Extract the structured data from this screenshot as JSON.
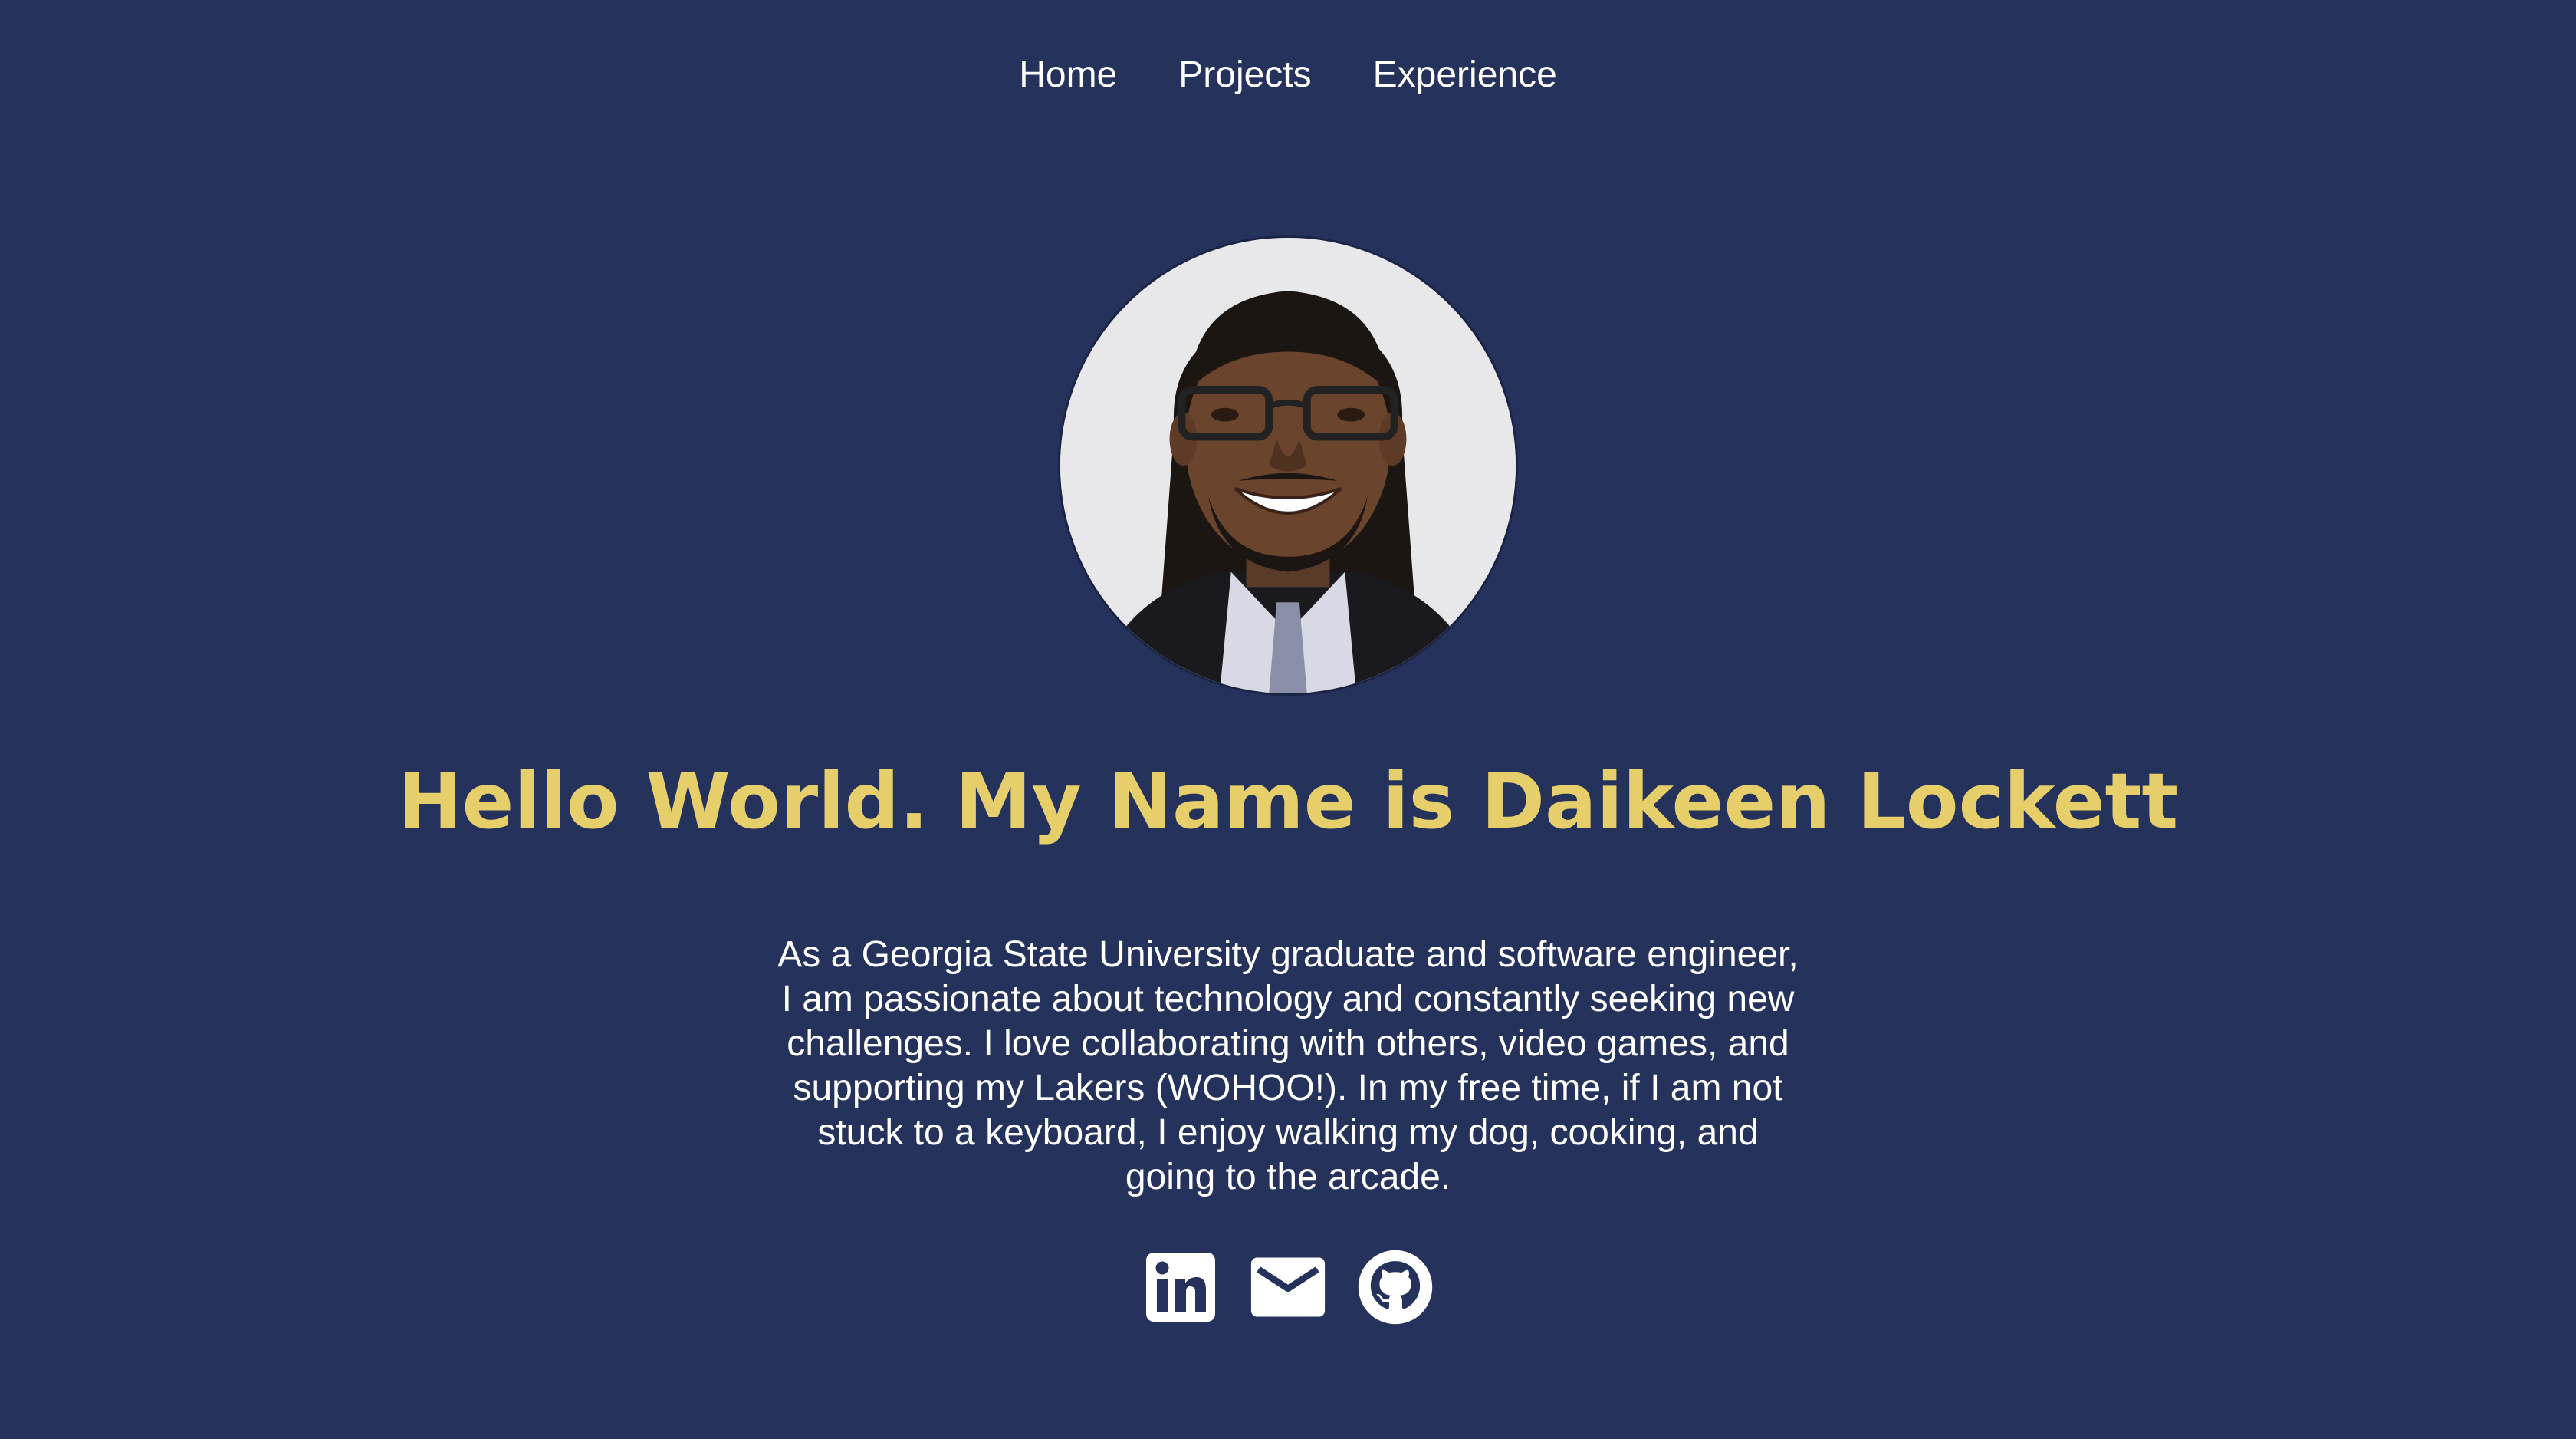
{
  "nav": {
    "items": [
      {
        "label": "Home"
      },
      {
        "label": "Projects"
      },
      {
        "label": "Experience"
      }
    ]
  },
  "profile": {
    "photo_alt": "portrait photo",
    "headline": "Hello World. My Name is Daikeen Lockett",
    "bio": "As a Georgia State University graduate and software engineer, I am passionate about technology and constantly seeking new challenges. I love collaborating with others, video games, and supporting my Lakers (WOHOO!). In my free time, if I am not stuck to a keyboard, I enjoy walking my dog, cooking, and going to the arcade."
  },
  "socials": [
    {
      "icon": "linkedin-icon"
    },
    {
      "icon": "email-icon"
    },
    {
      "icon": "github-icon"
    }
  ],
  "colors": {
    "background": "#25325b",
    "accent": "#e6cf6b",
    "text": "#ffffff"
  }
}
